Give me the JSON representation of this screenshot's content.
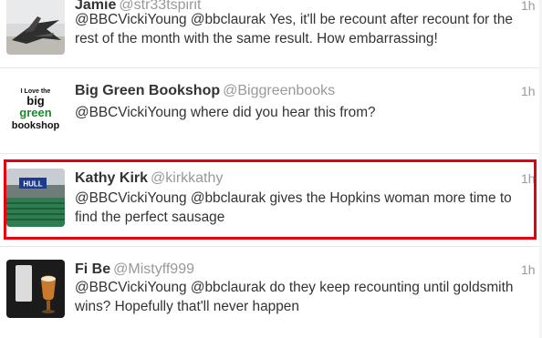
{
  "tweets": [
    {
      "name": "Jamie",
      "handle": "@str33tspirit",
      "time": "1h",
      "text": "@BBCVickiYoung @bbclaurak Yes, it'll be recount after recount for the rest of the month with the same result. How embarrassing!",
      "avatar_icon": "jet-aircraft-photo-icon"
    },
    {
      "name": "Big Green Bookshop",
      "handle": "@Biggreenbooks",
      "time": "1h",
      "text": "@BBCVickiYoung where did you hear this from?",
      "avatar_icon": "bookshop-logo-icon",
      "logo": {
        "line1": "I Love the",
        "line2": "big",
        "line3": "green",
        "line4": "bookshop"
      }
    },
    {
      "name": "Kathy Kirk",
      "handle": "@kirkkathy",
      "time": "1h",
      "text": "@BBCVickiYoung @bbclaurak gives the Hopkins woman more time to find the perfect sausage",
      "avatar_icon": "sports-stadium-photo-icon",
      "highlighted": true,
      "avatar_sign": "HULL"
    },
    {
      "name": "Fi Be",
      "handle": "@Mistyff999",
      "time": "1h",
      "text": "@BBCVickiYoung @bbclaurak do they keep recounting until goldsmith wins? Hopefully that'll never happen",
      "avatar_icon": "beer-glass-photo-icon"
    }
  ],
  "colors": {
    "highlight_border": "#e3000f",
    "name": "#333333",
    "handle": "#999999",
    "logo_green": "#1d8a2e"
  }
}
